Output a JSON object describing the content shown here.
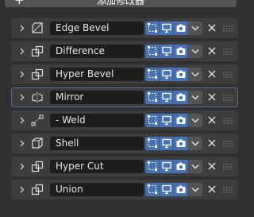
{
  "toolbar": {
    "add_label": "添加修改器",
    "add_icon": "plus-icon"
  },
  "modifiers": [
    {
      "name": "Edge Bevel",
      "icon": "bevel-icon",
      "active": false
    },
    {
      "name": "Difference",
      "icon": "boolean-icon",
      "active": false
    },
    {
      "name": "Hyper Bevel",
      "icon": "boolean-icon",
      "active": false
    },
    {
      "name": "Mirror",
      "icon": "mirror-icon",
      "active": true
    },
    {
      "name": "- Weld",
      "icon": "weld-icon",
      "active": false
    },
    {
      "name": "Shell",
      "icon": "solidify-icon",
      "active": false
    },
    {
      "name": "Hyper Cut",
      "icon": "boolean-icon",
      "active": false
    },
    {
      "name": "Union",
      "icon": "boolean-icon",
      "active": false
    }
  ],
  "colors": {
    "panel": "#3d3d3d",
    "field": "#1d1d1d",
    "accent": "#4772b3",
    "active_border": "#5d6f8e"
  }
}
